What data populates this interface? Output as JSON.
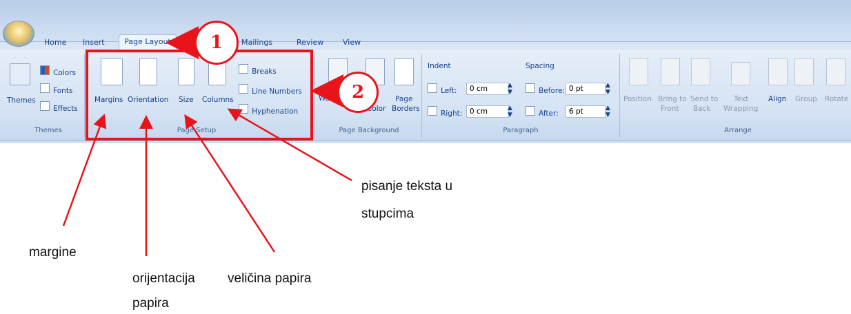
{
  "tabs": [
    {
      "label": "Home"
    },
    {
      "label": "Insert"
    },
    {
      "label": "Page Layout"
    },
    {
      "label": "Mailings"
    },
    {
      "label": "Review"
    },
    {
      "label": "View"
    }
  ],
  "themes_group": {
    "label": "Themes",
    "themes_button": "Themes",
    "colors": "Colors",
    "fonts": "Fonts",
    "effects": "Effects"
  },
  "page_setup": {
    "label": "Page Setup",
    "margins": "Margins",
    "orientation": "Orientation",
    "size": "Size",
    "columns": "Columns",
    "breaks": "Breaks",
    "line_numbers": "Line Numbers",
    "hyphenation": "Hyphenation"
  },
  "page_background": {
    "label": "Page Background",
    "watermark": "Waterm",
    "page_color": "Color",
    "page_borders_1": "Page",
    "page_borders_2": "Borders"
  },
  "paragraph": {
    "label": "Paragraph",
    "indent": "Indent",
    "left": "Left:",
    "right": "Right:",
    "left_value": "0 cm",
    "right_value": "0 cm",
    "spacing": "Spacing",
    "before": "Before:",
    "after": "After:",
    "before_value": "0 pt",
    "after_value": "6 pt"
  },
  "arrange": {
    "label": "Arrange",
    "position": "Position",
    "bring_to_front_1": "Bring to",
    "bring_to_front_2": "Front",
    "send_to_back_1": "Send to",
    "send_to_back_2": "Back",
    "text_wrapping_1": "Text",
    "text_wrapping_2": "Wrapping",
    "align": "Align",
    "group": "Group",
    "rotate": "Rotate"
  },
  "annotations": {
    "step1": "1",
    "step2": "2",
    "margine": "margine",
    "orijentacija_1": "orijentacija",
    "orijentacija_2": "papira",
    "velicina": "veličina papira",
    "pisanje_1": "pisanje teksta u",
    "pisanje_2": "stupcima"
  },
  "colors": {
    "annotation_red": "#e8141a",
    "ribbon_text": "#15428b"
  }
}
